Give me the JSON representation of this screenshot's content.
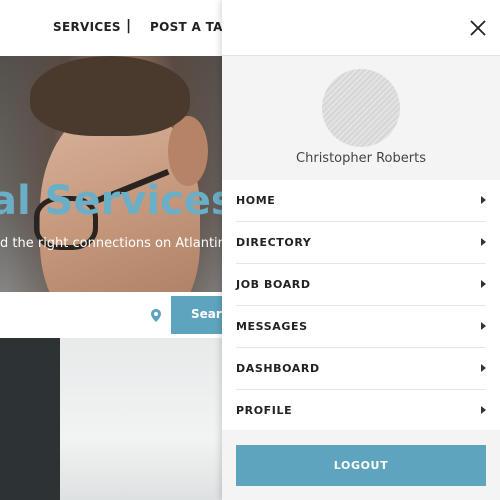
{
  "colors": {
    "accent": "#5fa4bf",
    "heading": "#6aaec7",
    "drawer_bg": "#f4f4f4"
  },
  "topnav": {
    "services_label": "SERVICES",
    "separator": "|",
    "post_task_label": "POST A TASK"
  },
  "hero": {
    "title": "al Services",
    "subtitle": "d the right connections on Atlantim"
  },
  "search": {
    "location_icon": "map-pin-icon",
    "button_label": "Search"
  },
  "drawer": {
    "close_icon": "close-icon",
    "user_name": "Christopher Roberts",
    "menu": [
      {
        "label": "HOME"
      },
      {
        "label": "DIRECTORY"
      },
      {
        "label": "JOB BOARD"
      },
      {
        "label": "MESSAGES"
      },
      {
        "label": "DASHBOARD"
      },
      {
        "label": "PROFILE"
      }
    ],
    "logout_label": "LOGOUT"
  }
}
